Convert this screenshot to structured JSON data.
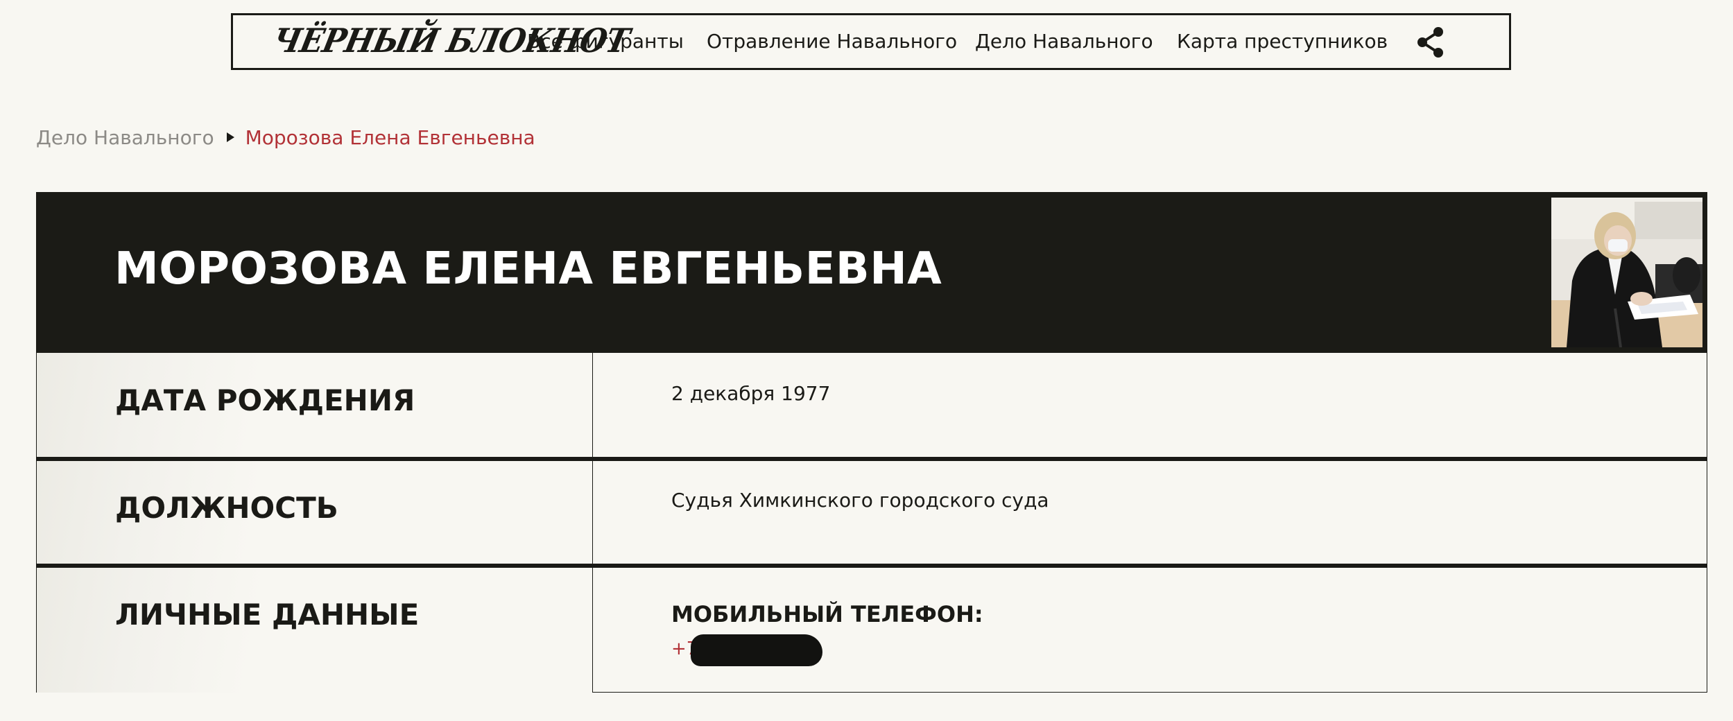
{
  "header": {
    "logo_text": "ЧЁРНЫЙ БЛОКНОТ",
    "nav": [
      {
        "label": "Все фигуранты"
      },
      {
        "label": "Отравление Навального"
      },
      {
        "label": "Дело Навального"
      },
      {
        "label": "Карта преступников"
      }
    ],
    "share_icon": "share-icon"
  },
  "breadcrumb": {
    "parent": "Дело Навального",
    "current": "Морозова Елена Евгеньевна"
  },
  "profile": {
    "name": "МОРОЗОВА ЕЛЕНА ЕВГЕНЬЕВНА",
    "rows": [
      {
        "label": "ДАТА РОЖДЕНИЯ",
        "value": "2 декабря 1977"
      },
      {
        "label": "ДОЛЖНОСТЬ",
        "value": "Судья Химкинского городского суда"
      },
      {
        "label": "ЛИЧНЫЕ ДАННЫЕ",
        "field_title": "МОБИЛЬНЫЙ ТЕЛЕФОН:",
        "field_value": "+7"
      }
    ]
  },
  "colors": {
    "background": "#f8f7f2",
    "dark": "#1b1b16",
    "accent_red": "#b23237",
    "muted": "#8c8a86"
  }
}
